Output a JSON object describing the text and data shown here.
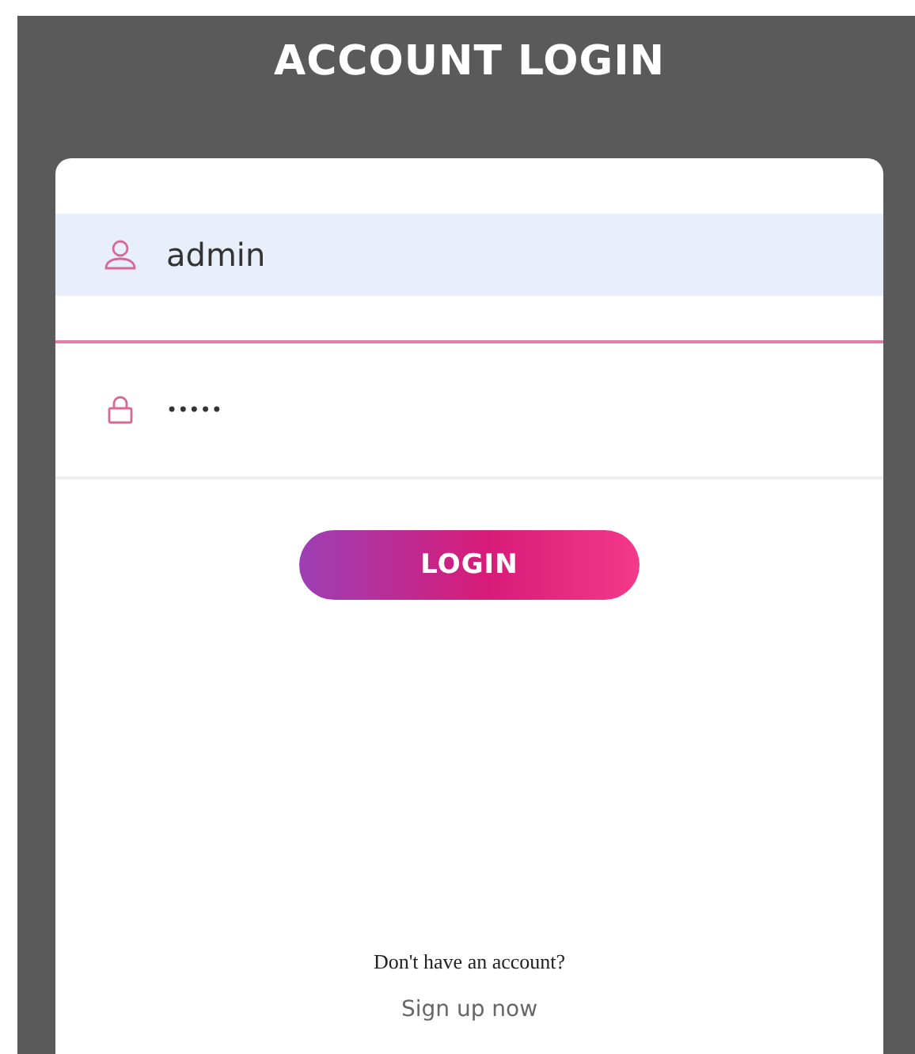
{
  "title": "ACCOUNT LOGIN",
  "fields": [
    {
      "kind": "user",
      "value": "admin"
    },
    {
      "kind": "password",
      "value": "•••••"
    }
  ],
  "login_button": "LOGIN",
  "signup_prompt": "Don't have an account?",
  "signup_link": "Sign up now"
}
